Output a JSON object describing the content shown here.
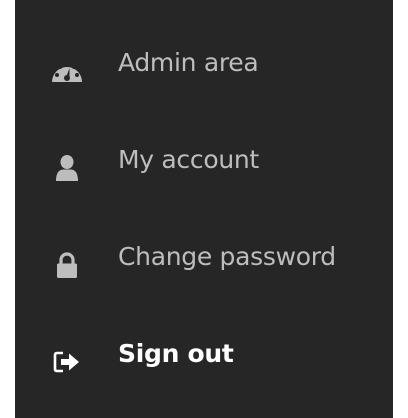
{
  "menu": {
    "items": [
      {
        "icon": "dashboard-gauge-icon",
        "label": "Admin area"
      },
      {
        "icon": "user-icon",
        "label": "My account"
      },
      {
        "icon": "lock-icon",
        "label": "Change password"
      },
      {
        "icon": "sign-out-icon",
        "label": "Sign out"
      }
    ]
  },
  "colors": {
    "background": "#262626",
    "item_text": "#bdbdbd",
    "active_text": "#ffffff"
  }
}
